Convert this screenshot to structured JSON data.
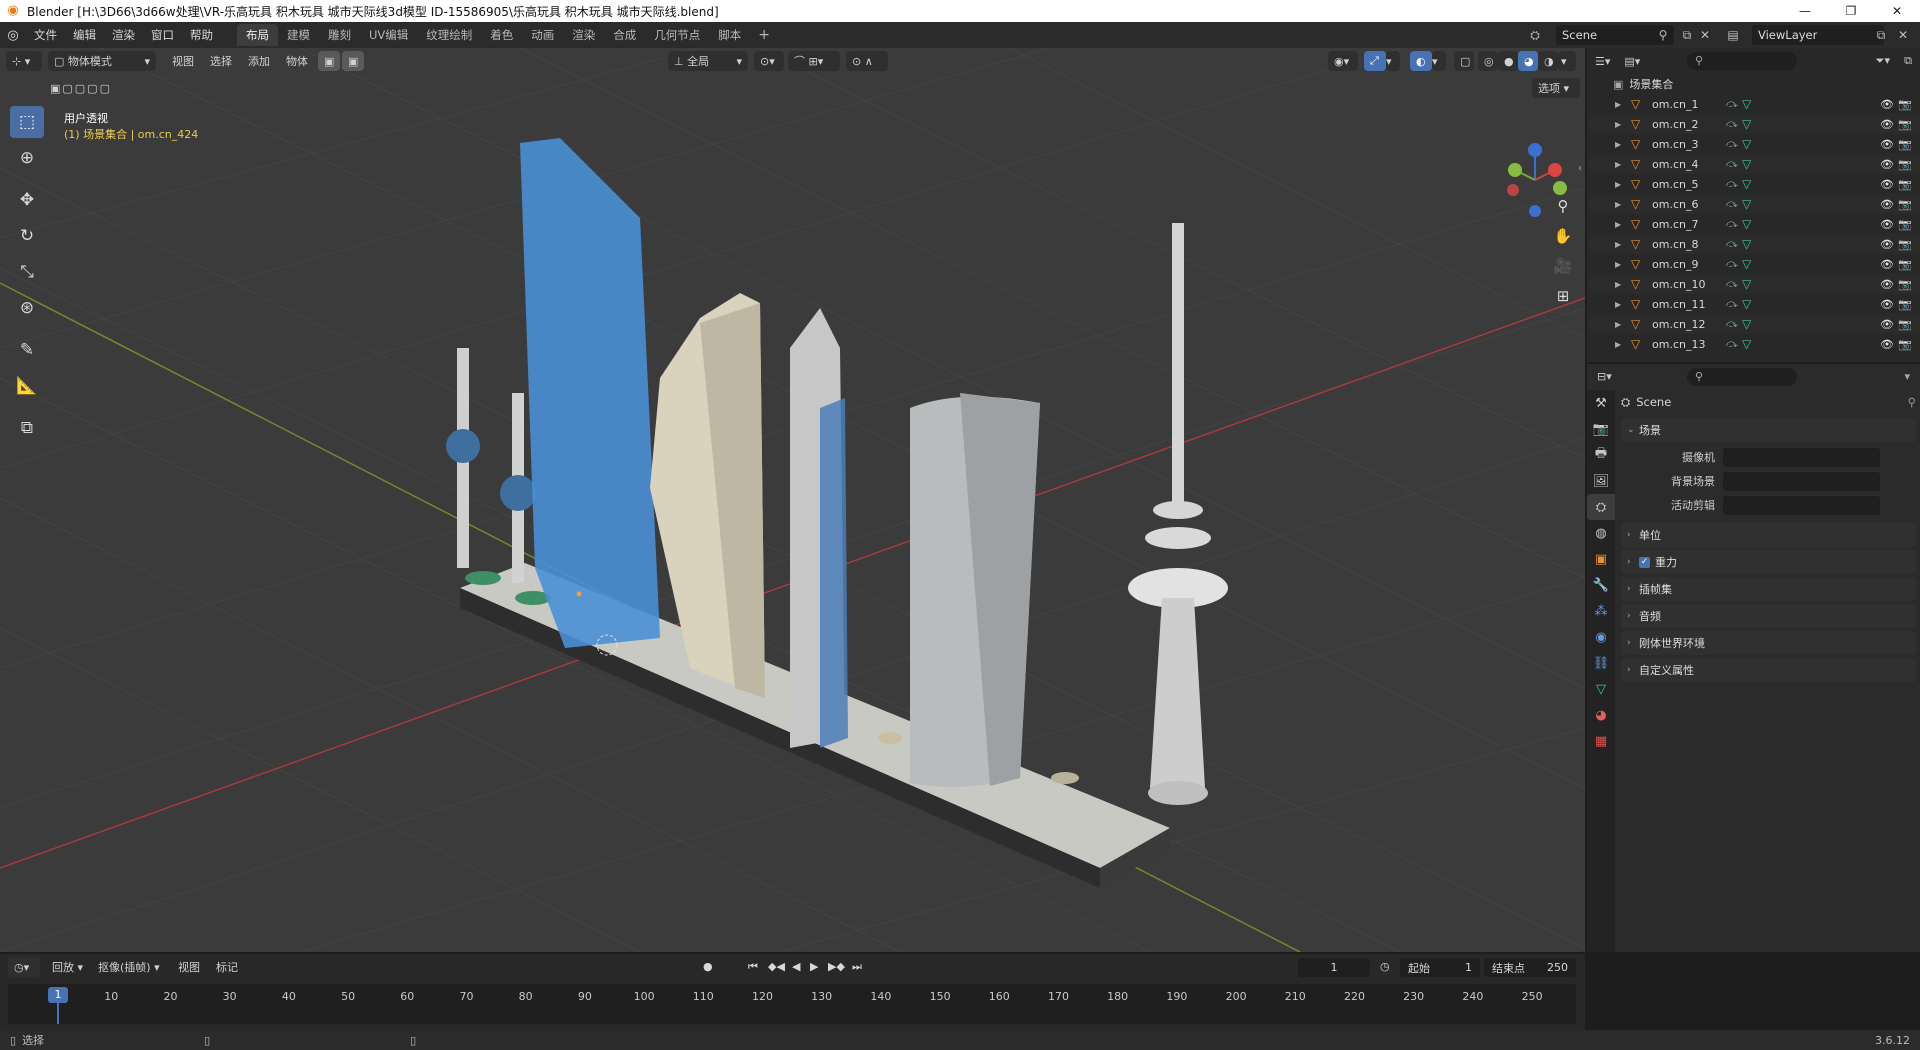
{
  "window": {
    "title": "Blender [H:\\3D66\\3d66w处理\\VR-乐高玩具 积木玩具 城市天际线3d模型 ID-15586905\\乐高玩具 积木玩具 城市天际线.blend]",
    "minimize": "—",
    "maximize": "❐",
    "close": "✕"
  },
  "menu": [
    "文件",
    "编辑",
    "渲染",
    "窗口",
    "帮助"
  ],
  "workspaces": [
    "布局",
    "建模",
    "雕刻",
    "UV编辑",
    "纹理绘制",
    "着色",
    "动画",
    "渲染",
    "合成",
    "几何节点",
    "脚本"
  ],
  "active_workspace": "布局",
  "scene_name": "Scene",
  "view_layer": "ViewLayer",
  "viewport": {
    "mode": "物体模式",
    "menus": [
      "视图",
      "选择",
      "添加",
      "物体"
    ],
    "transform_orientation": "全局",
    "options": "选项",
    "view_label": "用户透视",
    "collection_label": "(1) 场景集合 | om.cn_424"
  },
  "outliner": {
    "root": "场景集合",
    "items": [
      "om.cn_1",
      "om.cn_2",
      "om.cn_3",
      "om.cn_4",
      "om.cn_5",
      "om.cn_6",
      "om.cn_7",
      "om.cn_8",
      "om.cn_9",
      "om.cn_10",
      "om.cn_11",
      "om.cn_12",
      "om.cn_13"
    ]
  },
  "properties": {
    "title": "Scene",
    "panel_scene": "场景",
    "fields": [
      {
        "label": "摄像机"
      },
      {
        "label": "背景场景"
      },
      {
        "label": "活动剪辑"
      }
    ],
    "panels": [
      "单位",
      "重力",
      "插帧集",
      "音频",
      "刚体世界环境",
      "自定义属性"
    ]
  },
  "timeline": {
    "menus": [
      "回放",
      "抠像(插帧)",
      "视图",
      "标记"
    ],
    "current_frame": "1",
    "start_label": "起始",
    "start_value": "1",
    "end_label": "结束点",
    "end_value": "250",
    "ticks": [
      "10",
      "20",
      "30",
      "40",
      "50",
      "60",
      "70",
      "80",
      "90",
      "100",
      "110",
      "120",
      "130",
      "140",
      "150",
      "160",
      "170",
      "180",
      "190",
      "200",
      "210",
      "220",
      "230",
      "240",
      "250"
    ]
  },
  "status": {
    "select": "选择",
    "version": "3.6.12"
  },
  "colors": {
    "accent": "#4772b3",
    "viewport_bg": "#3b3b3b",
    "x_axis": "#c24a4a",
    "y_axis": "#8fb64a",
    "glass_blue": "#4a8fd6"
  }
}
